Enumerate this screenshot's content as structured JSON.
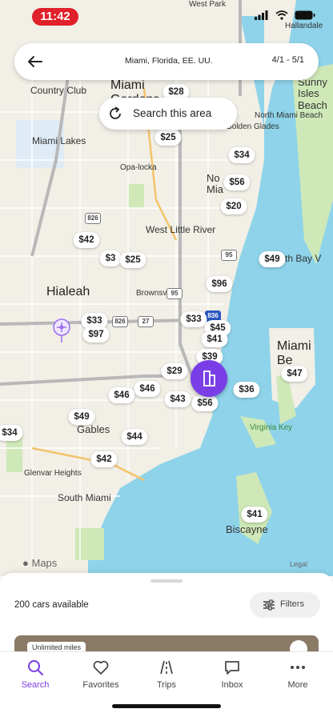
{
  "status_bar": {
    "time": "11:42"
  },
  "search": {
    "location": "Miami, Florida, EE. UU.",
    "dates": "4/1 - 5/1",
    "search_area_label": "Search this area"
  },
  "map": {
    "labels": {
      "west_park": "West Park",
      "hallandale": "Hallandale",
      "country_club": "Country Club",
      "miami_gardens": "Miami\nGardens",
      "sunny_isles": "Sunny\nIsles\nBeach",
      "north_miami_beach": "North Miami Beach",
      "golden_glades": "Golden Glades",
      "miami_lakes": "Miami Lakes",
      "opa_locka": "Opa-locka",
      "north_miami": "No\nMia",
      "west_little_river": "West Little River",
      "north_bay": "rth Bay V",
      "hialeah": "Hialeah",
      "brownsville": "Brownsville",
      "miami_beach": "Miami\nBe",
      "coral_gables": "ral\nGables",
      "glenvar_heights": "Glenvar Heights",
      "south_miami": "South Miami",
      "virginia_key": "Virginia Key",
      "key_biscayne": "Biscayne",
      "maps_attrib": "Maps",
      "legal": "Legal"
    },
    "highways": [
      "826",
      "95",
      "826",
      "95",
      "27",
      "836"
    ],
    "price_pins": [
      "$28",
      "$25",
      "$34",
      "$56",
      "$20",
      "$42",
      "$3",
      "$25",
      "$49",
      "$96",
      "$33",
      "$97",
      "$33",
      "$45",
      "$41",
      "$29",
      "$39",
      "$46",
      "$43",
      "$56",
      "$36",
      "$46",
      "$47",
      "$49",
      "$34",
      "$44",
      "$42",
      "$41"
    ]
  },
  "sheet": {
    "cars_available": "200 cars available",
    "filters_label": "Filters",
    "card_badge": "Unlimited miles"
  },
  "tabs": [
    {
      "label": "Search",
      "icon": "search-icon",
      "active": true
    },
    {
      "label": "Favorites",
      "icon": "heart-icon",
      "active": false
    },
    {
      "label": "Trips",
      "icon": "road-icon",
      "active": false
    },
    {
      "label": "Inbox",
      "icon": "chat-icon",
      "active": false
    },
    {
      "label": "More",
      "icon": "more-icon",
      "active": false
    }
  ],
  "colors": {
    "accent": "#7a3ee6",
    "water": "#8ed3ea",
    "land": "#f1efe6",
    "park": "#cfe8b8",
    "recording": "#e0202a"
  }
}
